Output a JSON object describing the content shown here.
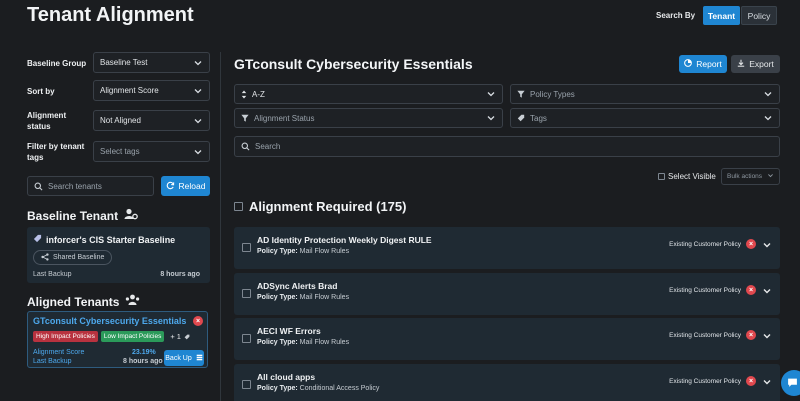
{
  "header": {
    "title": "Tenant Alignment",
    "search_by_label": "Search By",
    "search_by_options": [
      "Tenant",
      "Policy"
    ],
    "search_by_selected": "Tenant"
  },
  "sidebar": {
    "filters": {
      "baseline_group": {
        "label": "Baseline Group",
        "value": "Baseline Test"
      },
      "sort_by": {
        "label": "Sort by",
        "value": "Alignment Score"
      },
      "alignment_status": {
        "label": "Alignment status",
        "value": "Not Aligned"
      },
      "filter_tags": {
        "label": "Filter by tenant tags",
        "placeholder": "Select tags"
      }
    },
    "search_tenants_placeholder": "Search tenants",
    "reload_label": "Reload",
    "baseline_tenant": {
      "section_title": "Baseline Tenant",
      "name": "inforcer's CIS Starter Baseline",
      "shared_label": "Shared Baseline",
      "last_backup_label": "Last Backup",
      "last_backup_value": "8 hours ago"
    },
    "aligned_tenants": {
      "section_title": "Aligned Tenants",
      "tenant": {
        "name": "GTconsult Cybersecurity Essentials",
        "badges": [
          "High Impact Policies",
          "Low Impact Policies"
        ],
        "more_count": "+ 1",
        "alignment_score_label": "Alignment Score",
        "alignment_score_value": "23.19%",
        "last_backup_label": "Last Backup",
        "last_backup_value": "8 hours ago",
        "back_up_label": "Back Up"
      }
    }
  },
  "main": {
    "title": "GTconsult Cybersecurity Essentials",
    "report_label": "Report",
    "export_label": "Export",
    "sort_select": "A-Z",
    "policy_types_placeholder": "Policy Types",
    "alignment_status_placeholder": "Alignment Status",
    "tags_placeholder": "Tags",
    "search_placeholder": "Search",
    "select_visible_label": "Select Visible",
    "bulk_actions_label": "Bulk actions",
    "alignment_required_title": "Alignment Required (175)",
    "policy_type_label": "Policy Type:",
    "policies": [
      {
        "name": "AD Identity Protection Weekly Digest RULE",
        "type": "Mail Flow Rules",
        "status": "Existing Customer Policy"
      },
      {
        "name": "ADSync Alerts Brad",
        "type": "Mail Flow Rules",
        "status": "Existing Customer Policy"
      },
      {
        "name": "AECI WF Errors",
        "type": "Mail Flow Rules",
        "status": "Existing Customer Policy"
      },
      {
        "name": "All cloud apps",
        "type": "Conditional Access Policy",
        "status": "Existing Customer Policy"
      }
    ]
  },
  "colors": {
    "background": "#1b1d20",
    "card": "#1f2a33",
    "accent": "#1f86d2",
    "danger": "#e0484e",
    "success": "#2b9a5a",
    "highlight_text": "#4da8ec"
  }
}
